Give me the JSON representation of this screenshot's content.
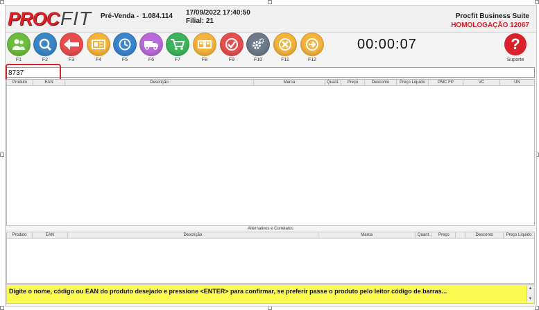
{
  "header": {
    "logo_proc": "PROC",
    "logo_fit": "FIT",
    "mode": "Pré-Venda -",
    "number": "1.084.114",
    "datetime": "17/09/2022 17:40:50",
    "filial": "Filial: 21",
    "suite": "Procfit Business Suite",
    "environment": "HOMOLOGAÇÃO 12067"
  },
  "toolbar": {
    "keys": [
      {
        "label": "F1",
        "icon": "users-icon",
        "color": "#6dbb3f"
      },
      {
        "label": "F2",
        "icon": "search-icon",
        "color": "#3b86c6"
      },
      {
        "label": "F3",
        "icon": "back-arrow-icon",
        "color": "#e84d4d"
      },
      {
        "label": "F4",
        "icon": "card-icon",
        "color": "#f4b33b"
      },
      {
        "label": "F5",
        "icon": "clock-icon",
        "color": "#3a84d0"
      },
      {
        "label": "F6",
        "icon": "truck-icon",
        "color": "#b96ad8"
      },
      {
        "label": "F7",
        "icon": "cart-icon",
        "color": "#3cb45a"
      },
      {
        "label": "F8",
        "icon": "cards-icon",
        "color": "#f4b33b"
      },
      {
        "label": "F9",
        "icon": "check-icon",
        "color": "#e84d4d"
      },
      {
        "label": "F10",
        "icon": "gear-icon",
        "color": "#6c7a89"
      },
      {
        "label": "F11",
        "icon": "close-icon",
        "color": "#f4b33b"
      },
      {
        "label": "F12",
        "icon": "forward-arrow-icon",
        "color": "#f4b33b"
      }
    ],
    "timer": "00:00:07",
    "support_label": "Suporte",
    "support_icon": "?"
  },
  "search": {
    "value": "8737"
  },
  "main_grid": {
    "columns": [
      "Produto",
      "EAN",
      "Descrição",
      "Marca",
      "Quant.",
      "Preço",
      "Desconto",
      "Preço Liquido",
      "PMC FP",
      "VC",
      "UN"
    ]
  },
  "alt_grid": {
    "title": "Alternativos e Correlatos",
    "columns": [
      "Produto",
      "EAN",
      "Descrição",
      "Marca",
      "Quant.",
      "Preço",
      "",
      "Desconto",
      "Preço Liquido"
    ]
  },
  "status": {
    "message": "Digite o nome, código ou EAN do produto desejado e pressione <ENTER> para confirmar, se preferir passe o produto pelo leitor código de barras..."
  },
  "colors": {
    "accent": "#d8212b",
    "status_bg": "#fafa50"
  }
}
